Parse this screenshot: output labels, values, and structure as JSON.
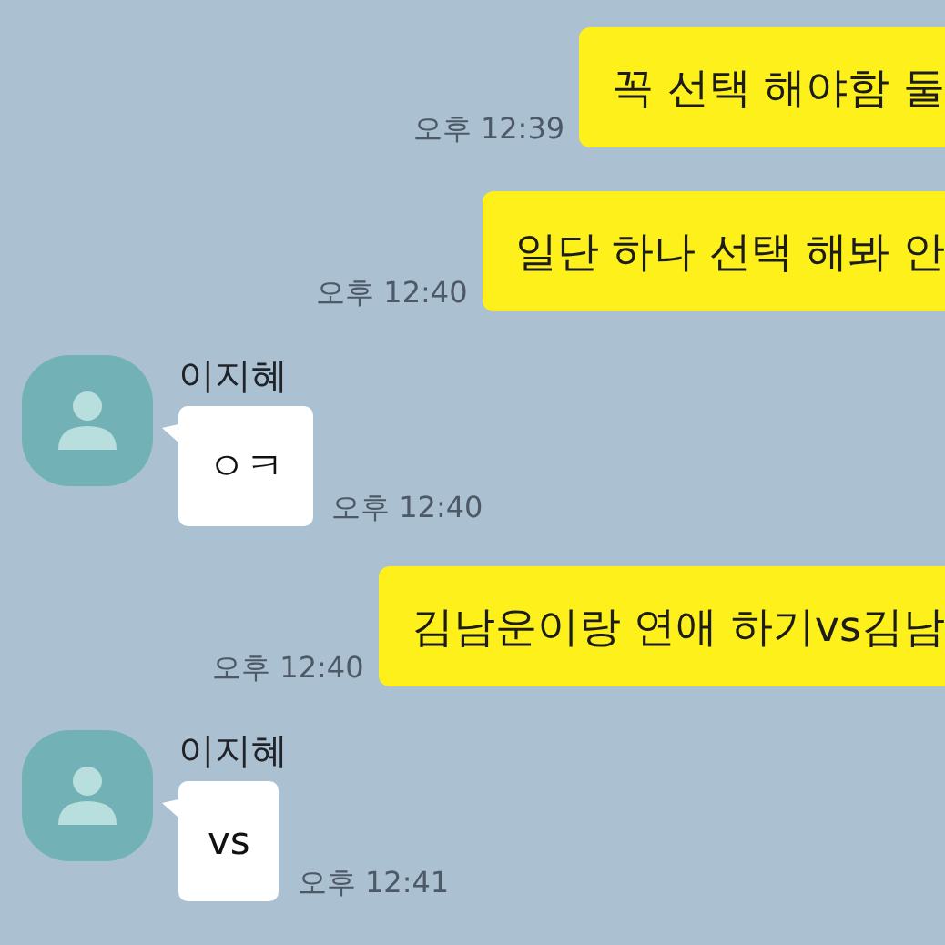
{
  "messages": [
    {
      "kind": "sent",
      "text": "꼭 선택 해야함 둘",
      "time": "오후 12:39"
    },
    {
      "kind": "sent",
      "text": "일단 하나 선택 해봐 안",
      "time": "오후 12:40"
    },
    {
      "kind": "received",
      "sender": "이지혜",
      "text": "ㅇㅋ",
      "time": "오후 12:40"
    },
    {
      "kind": "sent",
      "text": "김남운이랑 연애 하기vs김남",
      "time": "오후 12:40"
    },
    {
      "kind": "received",
      "sender": "이지혜",
      "text": "vs",
      "time": "오후 12:41"
    }
  ]
}
